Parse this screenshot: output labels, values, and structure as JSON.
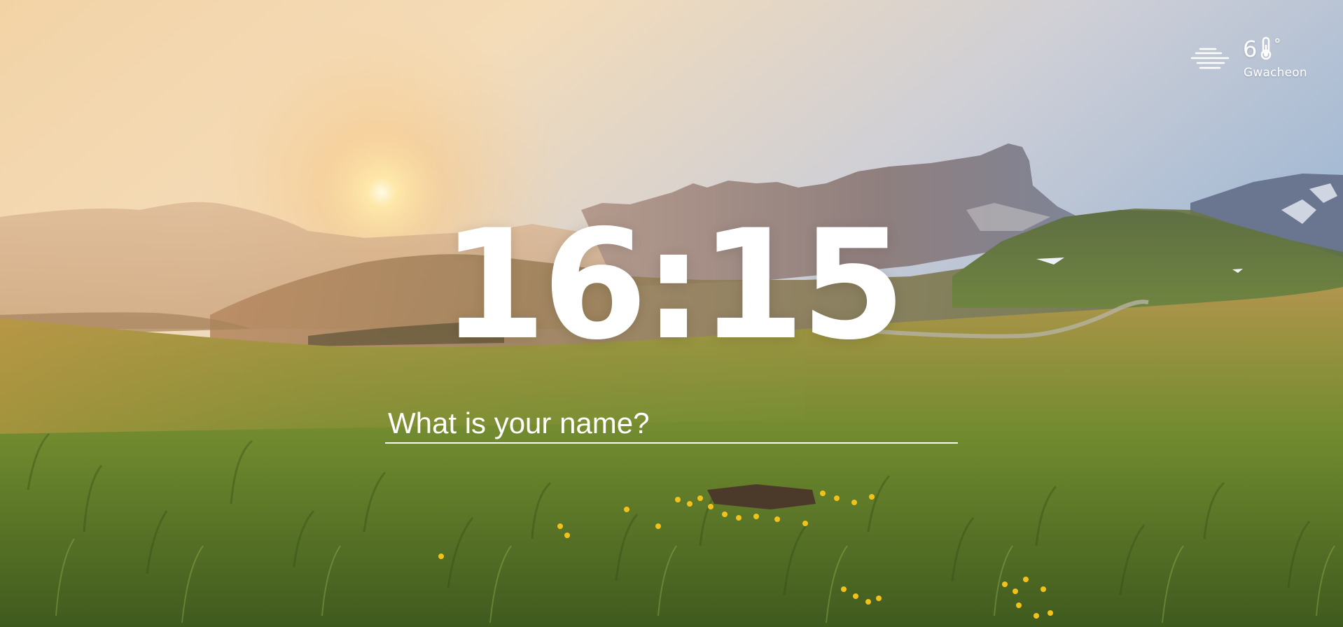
{
  "background": {
    "description_icon": "landscape-photo",
    "sky_top_color": "#9fb6d2",
    "sun_color": "#fff2c8",
    "grass_color": "#6f8a2e"
  },
  "weather": {
    "icon": "fog-icon",
    "temperature": "6",
    "degree_symbol": "°",
    "temperature_icon": "thermometer-icon",
    "location": "Gwacheon"
  },
  "clock": {
    "time": "16:15"
  },
  "greeting": {
    "placeholder": "What is your name?",
    "value": ""
  }
}
